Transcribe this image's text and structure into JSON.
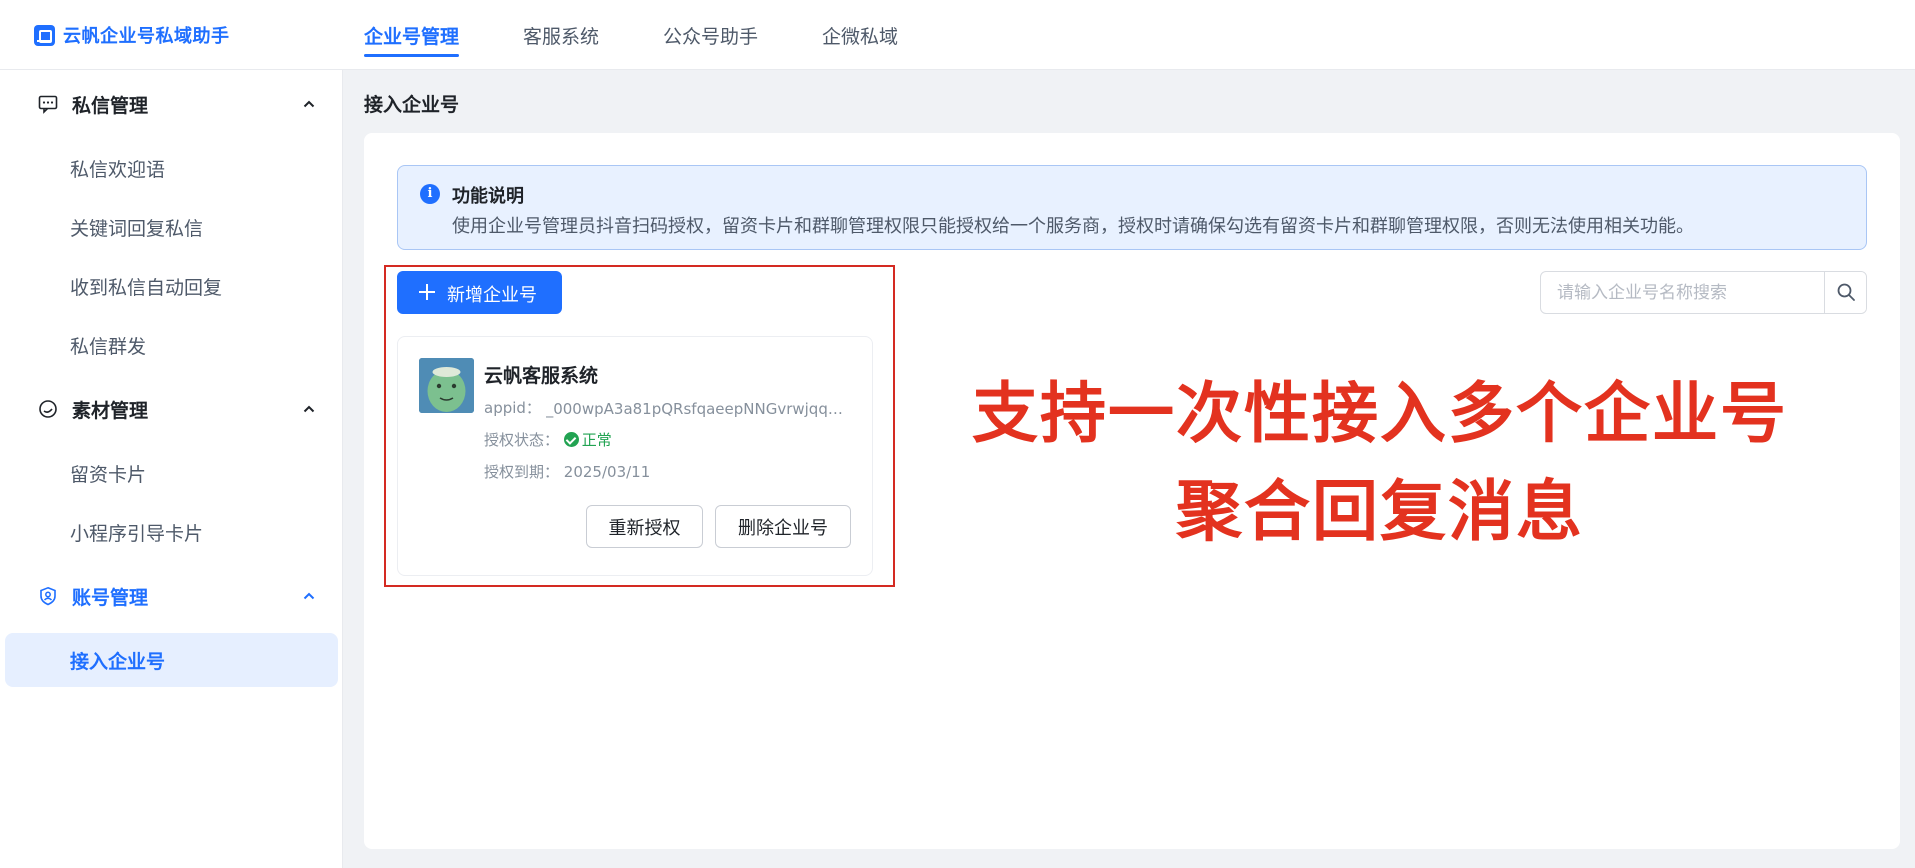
{
  "app": {
    "brand": "云帆企业号私域助手"
  },
  "topnav": {
    "items": [
      {
        "label": "企业号管理",
        "active": true
      },
      {
        "label": "客服系统",
        "active": false
      },
      {
        "label": "公众号助手",
        "active": false
      },
      {
        "label": "企微私域",
        "active": false
      }
    ]
  },
  "sidebar": {
    "groups": [
      {
        "label": "私信管理",
        "icon": "message-icon",
        "expanded": true,
        "items": [
          {
            "label": "私信欢迎语"
          },
          {
            "label": "关键词回复私信"
          },
          {
            "label": "收到私信自动回复"
          },
          {
            "label": "私信群发"
          }
        ]
      },
      {
        "label": "素材管理",
        "icon": "material-icon",
        "expanded": true,
        "items": [
          {
            "label": "留资卡片"
          },
          {
            "label": "小程序引导卡片"
          }
        ]
      },
      {
        "label": "账号管理",
        "icon": "shield-icon",
        "expanded": true,
        "items": [
          {
            "label": "接入企业号",
            "active": true
          }
        ]
      }
    ]
  },
  "page": {
    "title": "接入企业号"
  },
  "notice": {
    "title": "功能说明",
    "desc": "使用企业号管理员抖音扫码授权，留资卡片和群聊管理权限只能授权给一个服务商，授权时请确保勾选有留资卡片和群聊管理权限，否则无法使用相关功能。"
  },
  "actions": {
    "add_label": "新增企业号"
  },
  "search": {
    "placeholder": "请输入企业号名称搜索",
    "value": ""
  },
  "account_card": {
    "name": "云帆客服系统",
    "appid_label": "appid：",
    "appid_value": "_000wpA3a81pQRsfqaeepNNGvrwjqqzBJ...",
    "status_label": "授权状态：",
    "status_value": "正常",
    "expire_label": "授权到期：",
    "expire_value": "2025/03/11",
    "reauth_label": "重新授权",
    "delete_label": "删除企业号"
  },
  "promo": {
    "line1": "支持一次性接入多个企业号",
    "line2": "聚合回复消息"
  },
  "colors": {
    "accent": "#1f6fff",
    "promo_red": "#e3321f",
    "highlight_border": "#d42a22",
    "status_ok": "#22a352"
  }
}
